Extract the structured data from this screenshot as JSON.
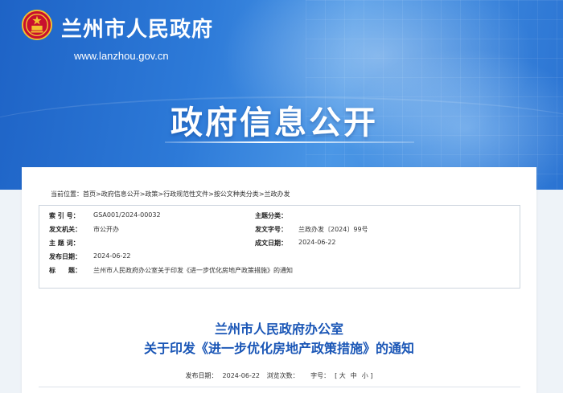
{
  "header": {
    "site_title": "兰州市人民政府",
    "site_url": "www.lanzhou.gov.cn",
    "banner_heading": "政府信息公开"
  },
  "breadcrumb": {
    "label": "当前位置：",
    "items": [
      "首页",
      "政府信息公开",
      "政策",
      "行政规范性文件",
      "按公文种类分类",
      "兰政办发"
    ],
    "separator": ">"
  },
  "info": {
    "index_label": "索 引 号：",
    "index_value": "GSA001/2024-00032",
    "category_label": "主题分类：",
    "category_value": "",
    "issuer_label": "发文机关：",
    "issuer_value": "市公开办",
    "doc_number_label": "发文字号：",
    "doc_number_value": "兰政办发〔2024〕99号",
    "keywords_label": "主 题 词：",
    "keywords_value": "",
    "created_label": "成文日期：",
    "created_value": "2024-06-22",
    "published_label": "发布日期：",
    "published_value": "2024-06-22",
    "title_label": "标　　题：",
    "title_value": "兰州市人民政府办公室关于印发《进一步优化房地产政策措施》的通知"
  },
  "notice": {
    "title_line1": "兰州市人民政府办公室",
    "title_line2": "关于印发《进一步优化房地产政策措施》的通知",
    "publish_date_label": "发布日期：",
    "publish_date_value": "2024-06-22",
    "views_label": "浏览次数：",
    "views_value": "",
    "font_size_label": "字号：",
    "font_sizes": [
      "[ 大",
      "中",
      "小 ]"
    ]
  },
  "colors": {
    "banner": "#2d7ad8",
    "title_blue": "#1a56b6",
    "page_bg": "#eef3f8"
  }
}
